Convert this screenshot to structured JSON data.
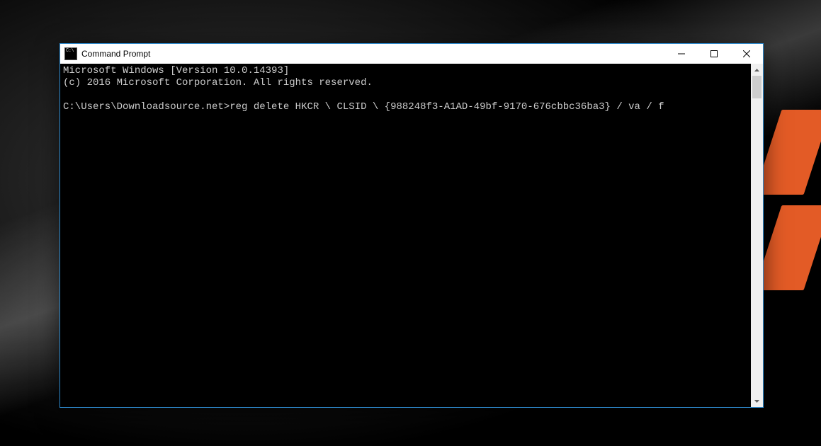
{
  "window": {
    "title": "Command Prompt"
  },
  "console": {
    "line1": "Microsoft Windows [Version 10.0.14393]",
    "line2": "(c) 2016 Microsoft Corporation. All rights reserved.",
    "blank": "",
    "prompt": "C:\\Users\\Downloadsource.net>",
    "command": "reg delete HKCR \\ CLSID \\ {988248f3-A1AD-49bf-9170-676cbbc36ba3} / va / f"
  }
}
